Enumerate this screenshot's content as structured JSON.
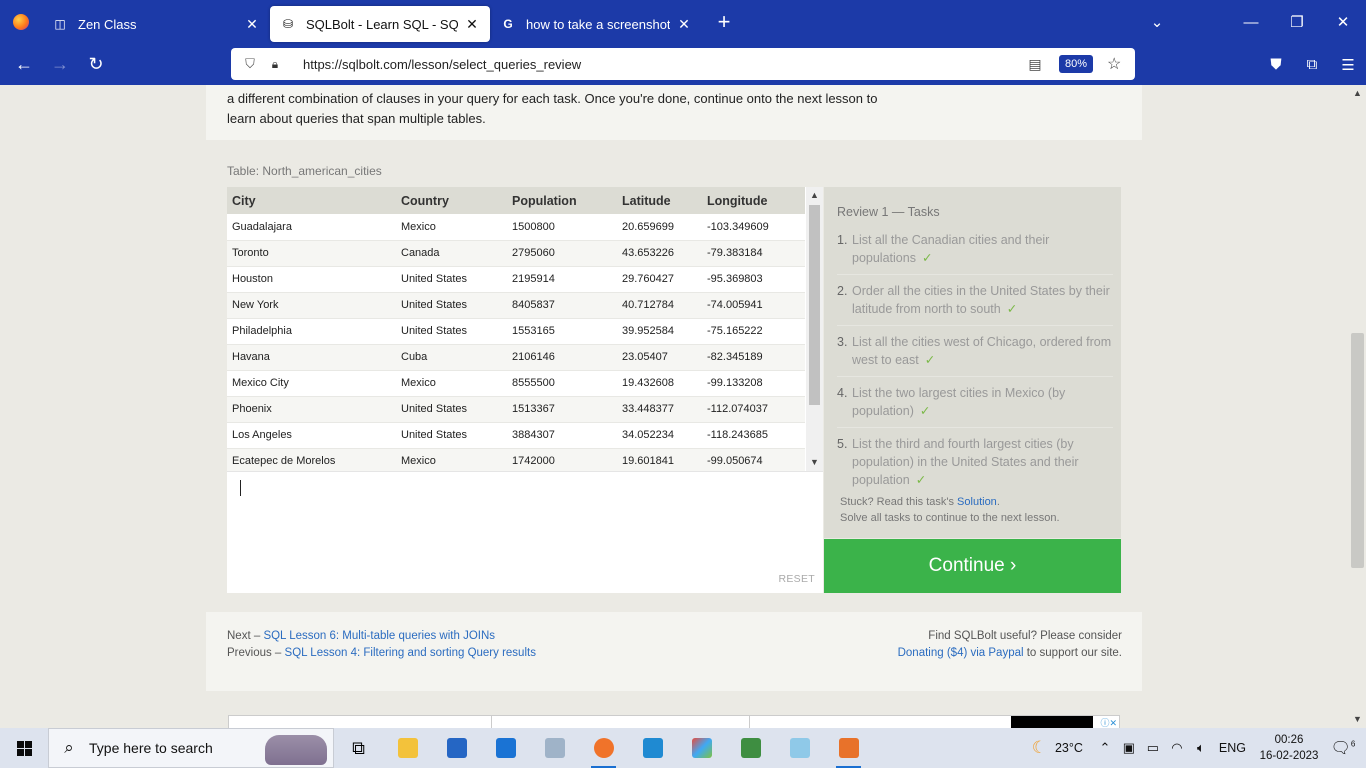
{
  "browser": {
    "tabs": [
      {
        "title": "Zen Class",
        "favicon": "zen-icon",
        "active": false
      },
      {
        "title": "SQLBolt - Learn SQL - SQL Revie",
        "favicon": "database-icon",
        "active": true
      },
      {
        "title": "how to take a screenshot on fire",
        "favicon": "google-icon",
        "active": false
      }
    ],
    "url": "https://sqlbolt.com/lesson/select_queries_review",
    "zoom": "80%"
  },
  "page": {
    "intro": "a different combination of clauses in your query for each task. Once you're done, continue onto the next lesson to learn about queries that span multiple tables.",
    "table_caption": "Table: North_american_cities",
    "table": {
      "headers": [
        "City",
        "Country",
        "Population",
        "Latitude",
        "Longitude"
      ],
      "rows": [
        [
          "Guadalajara",
          "Mexico",
          "1500800",
          "20.659699",
          "-103.349609"
        ],
        [
          "Toronto",
          "Canada",
          "2795060",
          "43.653226",
          "-79.383184"
        ],
        [
          "Houston",
          "United States",
          "2195914",
          "29.760427",
          "-95.369803"
        ],
        [
          "New York",
          "United States",
          "8405837",
          "40.712784",
          "-74.005941"
        ],
        [
          "Philadelphia",
          "United States",
          "1553165",
          "39.952584",
          "-75.165222"
        ],
        [
          "Havana",
          "Cuba",
          "2106146",
          "23.05407",
          "-82.345189"
        ],
        [
          "Mexico City",
          "Mexico",
          "8555500",
          "19.432608",
          "-99.133208"
        ],
        [
          "Phoenix",
          "United States",
          "1513367",
          "33.448377",
          "-112.074037"
        ],
        [
          "Los Angeles",
          "United States",
          "3884307",
          "34.052234",
          "-118.243685"
        ],
        [
          "Ecatepec de Morelos",
          "Mexico",
          "1742000",
          "19.601841",
          "-99.050674"
        ]
      ]
    },
    "editor": {
      "reset_label": "RESET"
    },
    "tasks": {
      "title": "Review 1 — Tasks",
      "items": [
        {
          "num": "1.",
          "text": "List all the Canadian cities and their populations",
          "check": "✓"
        },
        {
          "num": "2.",
          "text": "Order all the cities in the United States by their latitude from north to south",
          "check": "✓"
        },
        {
          "num": "3.",
          "text": "List all the cities west of Chicago, ordered from west to east",
          "check": "✓"
        },
        {
          "num": "4.",
          "text": "List the two largest cities in Mexico (by population)",
          "check": "✓"
        },
        {
          "num": "5.",
          "text": "List the third and fourth largest cities (by population) in the United States and their population",
          "check": "✓"
        }
      ],
      "stuck_prefix": "Stuck? Read this task's ",
      "solution_link": "Solution",
      "stuck_suffix": ".",
      "solve_all": "Solve all tasks to continue to the next lesson."
    },
    "continue_label": "Continue ›",
    "footer": {
      "next_prefix": "Next – ",
      "next_link": "SQL Lesson 6: Multi-table queries with JOINs",
      "prev_prefix": "Previous – ",
      "prev_link": "SQL Lesson 4: Filtering and sorting Query results",
      "useful": "Find SQLBolt useful? Please consider",
      "donate_link": "Donating ($4) via Paypal",
      "donate_suffix": " to support our site."
    }
  },
  "taskbar": {
    "search_placeholder": "Type here to search",
    "weather": "23°C",
    "lang": "ENG",
    "time": "00:26",
    "date": "16-02-2023",
    "notifications": "6"
  },
  "colors": {
    "browser_chrome": "#1c3aa8",
    "continue_green": "#3bb34a",
    "link_blue": "#2b6cc0",
    "check_green": "#7cb94a"
  }
}
